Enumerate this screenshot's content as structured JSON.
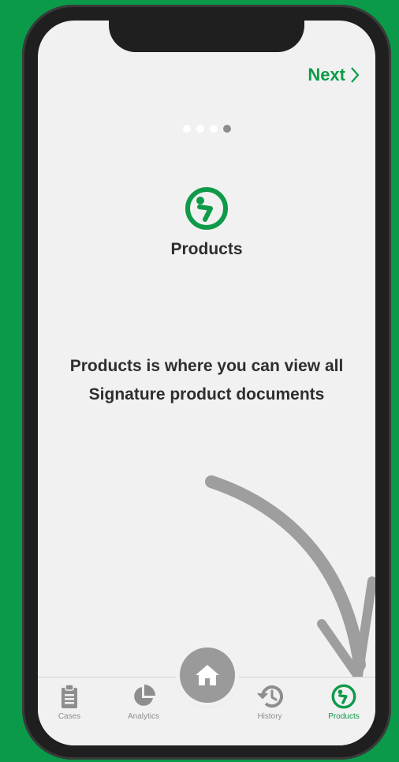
{
  "header": {
    "next_label": "Next"
  },
  "pager": {
    "total": 4,
    "active_index": 3
  },
  "hero": {
    "title": "Products",
    "icon": "products-icon"
  },
  "description": {
    "line1": "Products is where you can view all",
    "line2": "Signature product documents"
  },
  "tabbar": {
    "tabs": [
      {
        "label": "Cases",
        "icon": "clipboard-icon"
      },
      {
        "label": "Analytics",
        "icon": "pie-chart-icon"
      },
      {
        "label": "History",
        "icon": "history-icon"
      },
      {
        "label": "Products",
        "icon": "products-icon"
      }
    ],
    "home_icon": "home-icon",
    "active_tab": "Products"
  },
  "colors": {
    "brand_green": "#0f9a4a",
    "inactive_gray": "#8e8e8e"
  }
}
